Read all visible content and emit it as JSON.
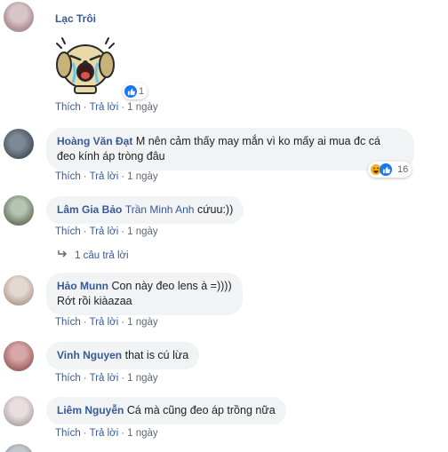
{
  "comments": [
    {
      "author": "Lạc Trôi",
      "text": "",
      "sticker": "crying-dog-sticker",
      "reaction_count": "1",
      "actions": {
        "like": "Thích",
        "reply": "Trả lời",
        "time": "1 ngày"
      }
    },
    {
      "author": "Hoàng Văn Đạt",
      "text_line1": "M nên cảm thấy may mắn vì ko mấy ai mua đc cá",
      "text_line2": "đeo kính áp tròng đâu",
      "reaction_count": "16",
      "actions": {
        "like": "Thích",
        "reply": "Trả lời",
        "time": "1 ngày"
      }
    },
    {
      "author": "Lâm Gia Bảo",
      "mention": "Trần Minh Anh",
      "text": "cứuu:))",
      "actions": {
        "like": "Thích",
        "reply": "Trả lời",
        "time": "1 ngày"
      },
      "replies_label": "1 câu trả lời"
    },
    {
      "author": "Hảo Munn",
      "text_line1": "Con này đeo lens à =))))",
      "text_line2": "Rớt rồi kiàazaa",
      "actions": {
        "like": "Thích",
        "reply": "Trả lời",
        "time": "1 ngày"
      }
    },
    {
      "author": "Vinh Nguyen",
      "text": "that is cú lừa",
      "actions": {
        "like": "Thích",
        "reply": "Trả lời",
        "time": "1 ngày"
      }
    },
    {
      "author": "Liêm Nguyễn",
      "text": "Cá mà cũng đeo áp trồng nữa",
      "actions": {
        "like": "Thích",
        "reply": "Trả lời",
        "time": "1 ngày"
      }
    }
  ],
  "separator": "·",
  "colors": {
    "link": "#385898",
    "bubble": "#f2f3f5",
    "meta": "#606770",
    "like": "#1877f2",
    "haha": "#f7b125"
  }
}
